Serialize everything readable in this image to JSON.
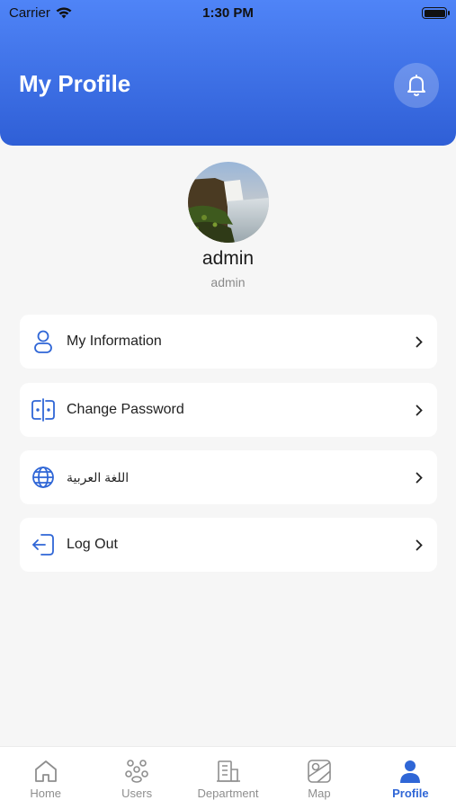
{
  "status_bar": {
    "carrier": "Carrier",
    "time": "1:30 PM"
  },
  "header": {
    "title": "My Profile"
  },
  "profile": {
    "name": "admin",
    "username": "admin"
  },
  "menu": [
    {
      "label": "My Information",
      "icon": "user-icon"
    },
    {
      "label": "Change Password",
      "icon": "password-icon"
    },
    {
      "label": "اللغة العربية",
      "icon": "globe-icon"
    },
    {
      "label": "Log Out",
      "icon": "logout-icon"
    }
  ],
  "tabs": [
    {
      "label": "Home",
      "icon": "home-icon"
    },
    {
      "label": "Users",
      "icon": "users-icon"
    },
    {
      "label": "Department",
      "icon": "building-icon"
    },
    {
      "label": "Map",
      "icon": "map-icon"
    },
    {
      "label": "Profile",
      "icon": "profile-icon",
      "active": true
    }
  ],
  "colors": {
    "accent": "#2f66d6",
    "header_top": "#4f84f7",
    "header_bottom": "#2f5fd6"
  }
}
